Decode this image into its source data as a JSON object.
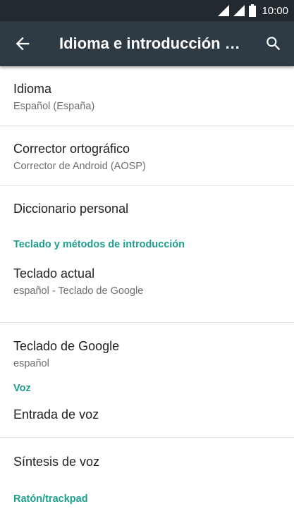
{
  "status_bar": {
    "time": "10:00"
  },
  "app_bar": {
    "title": "Idioma e introducción de texto"
  },
  "items": {
    "idioma": {
      "title": "Idioma",
      "summary": "Español (España)"
    },
    "corrector": {
      "title": "Corrector ortográfico",
      "summary": "Corrector de Android (AOSP)"
    },
    "diccionario": {
      "title": "Diccionario personal"
    },
    "teclado_actual": {
      "title": "Teclado actual",
      "summary": "español - Teclado de Google"
    },
    "teclado_google": {
      "title": "Teclado de Google",
      "summary": "español"
    },
    "entrada_voz": {
      "title": "Entrada de voz"
    },
    "sintesis_voz": {
      "title": "Síntesis de voz"
    }
  },
  "categories": {
    "teclado": "Teclado y métodos de introducción",
    "voz": "Voz",
    "raton": "Ratón/trackpad"
  },
  "colors": {
    "status_bar": "#222a30",
    "app_bar": "#2e3b44",
    "accent": "#1e9e8c",
    "primary_text": "#212121",
    "secondary_text": "#6d6d6d"
  }
}
